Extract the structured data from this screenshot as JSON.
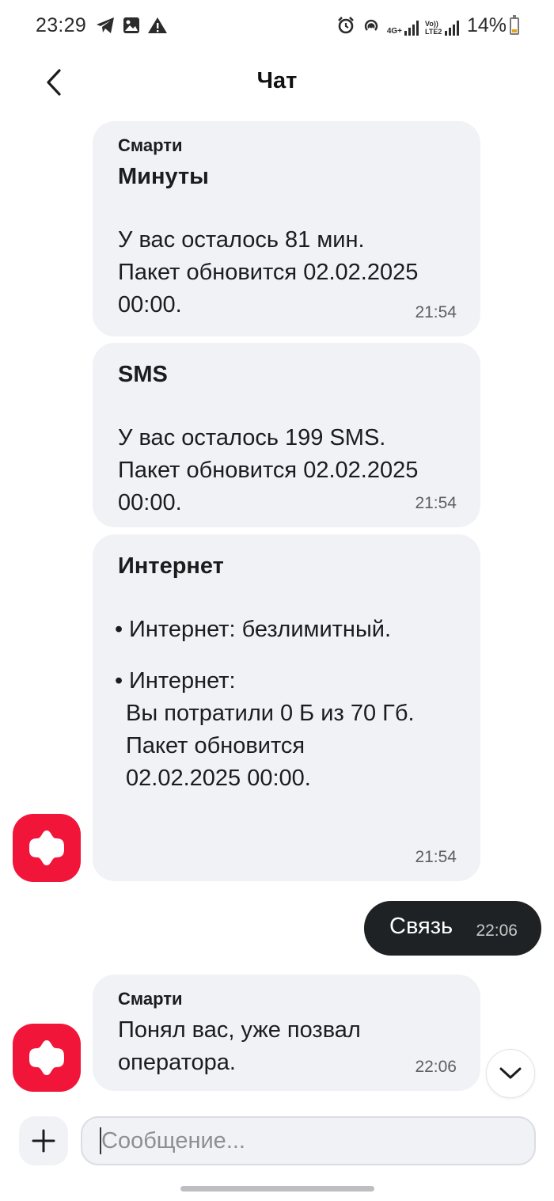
{
  "status_bar": {
    "time": "23:29",
    "battery": "14%",
    "icons_left": [
      "telegram-icon",
      "gallery-icon",
      "warning-icon"
    ],
    "icons_right": [
      "alarm-icon",
      "hotspot-icon",
      "4g-signal-icon",
      "volte-signal-icon"
    ],
    "network_label_1": "4G+",
    "network_label_2": "Vo)) LTE2"
  },
  "header": {
    "title": "Чат"
  },
  "messages": [
    {
      "sender": "Смарти",
      "title": "Минуты",
      "text": "У вас осталось 81 мин.\nПакет обновится 02.02.2025\n00:00.",
      "time": "21:54"
    },
    {
      "title": "SMS",
      "text": "У вас осталось 199 SMS.\nПакет обновится 02.02.2025\n00:00.",
      "time": "21:54"
    },
    {
      "title": "Интернет",
      "bullet1": "Интернет: безлимитный.",
      "bullet2": "Интернет:",
      "bullet2_detail": "Вы потратили 0 Б из 70 Гб.\nПакет обновится\n02.02.2025 00:00.",
      "time": "21:54"
    },
    {
      "outgoing": true,
      "text": "Связь",
      "time": "22:06"
    },
    {
      "sender": "Смарти",
      "text": "Понял вас, уже позвал\nоператора.",
      "time": "22:06"
    }
  ],
  "composer": {
    "placeholder": "Сообщение..."
  },
  "colors": {
    "brand": "#f2153a",
    "bubble_in": "#f1f2f6",
    "bubble_out": "#1f2224"
  }
}
